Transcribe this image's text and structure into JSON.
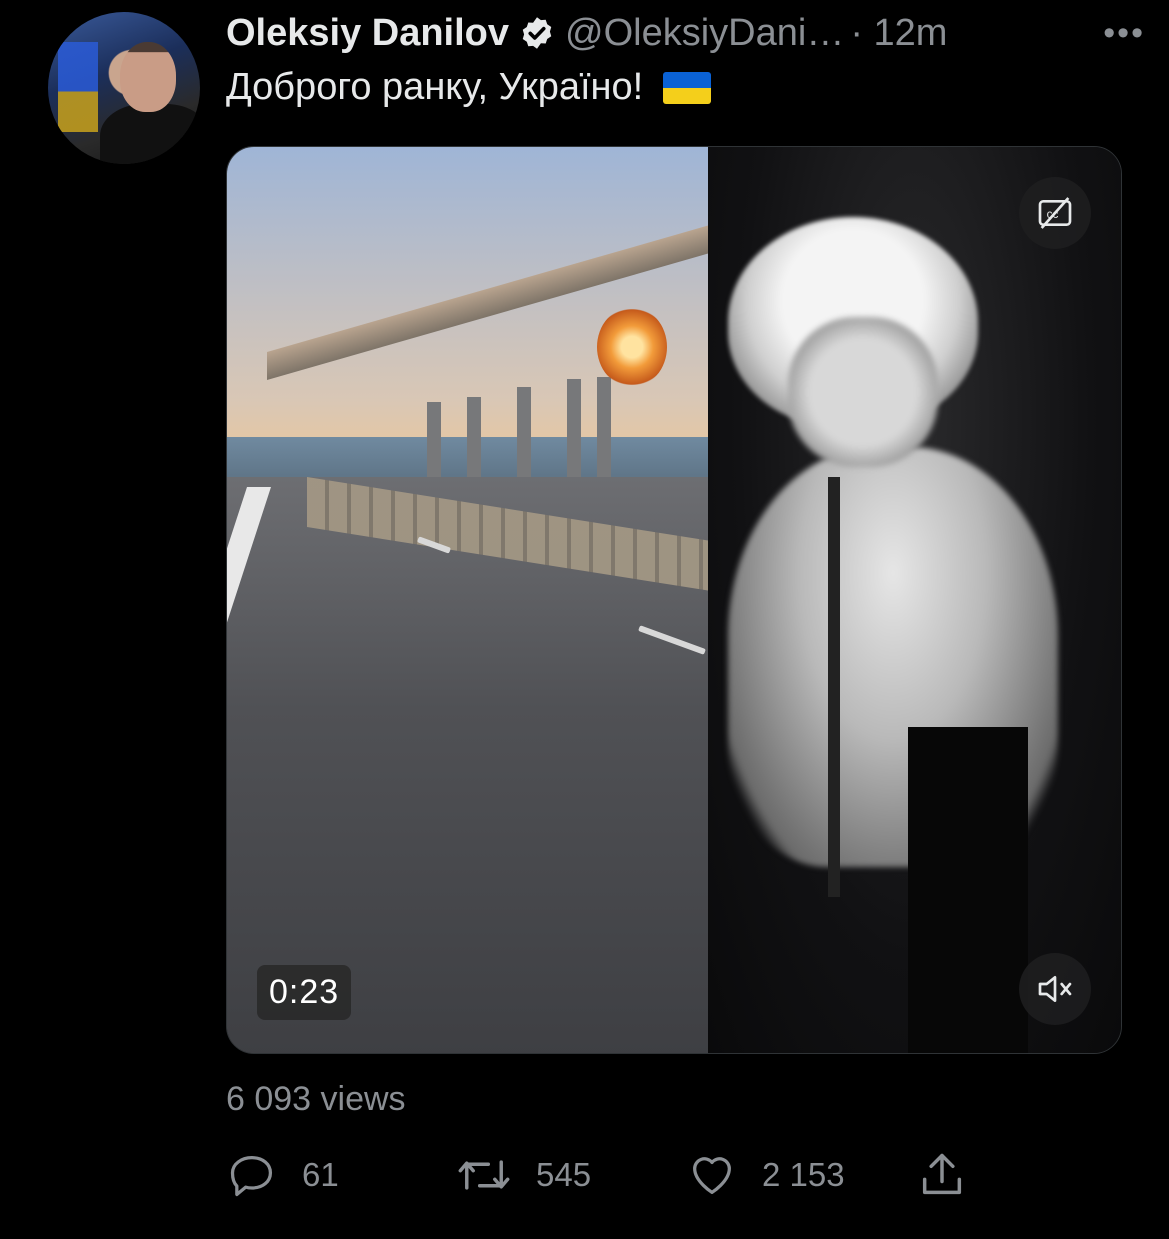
{
  "tweet": {
    "author_name": "Oleksiy Danilov",
    "handle": "@OleksiyDani…",
    "time": "· 12m",
    "more": "•••",
    "text": "Доброго ранку, Україно!",
    "flag_emoji_name": "ukraine-flag"
  },
  "video": {
    "duration": "0:23",
    "cc_icon": "closed-captions-off-icon",
    "mute_icon": "volume-muted-icon"
  },
  "stats": {
    "views": "6 093 views",
    "replies": "61",
    "retweets": "545",
    "likes": "2 153"
  },
  "colors": {
    "background": "#000000",
    "text": "#e7e9ea",
    "muted": "#8b8f94",
    "verified_badge": "#e7e9ea"
  }
}
